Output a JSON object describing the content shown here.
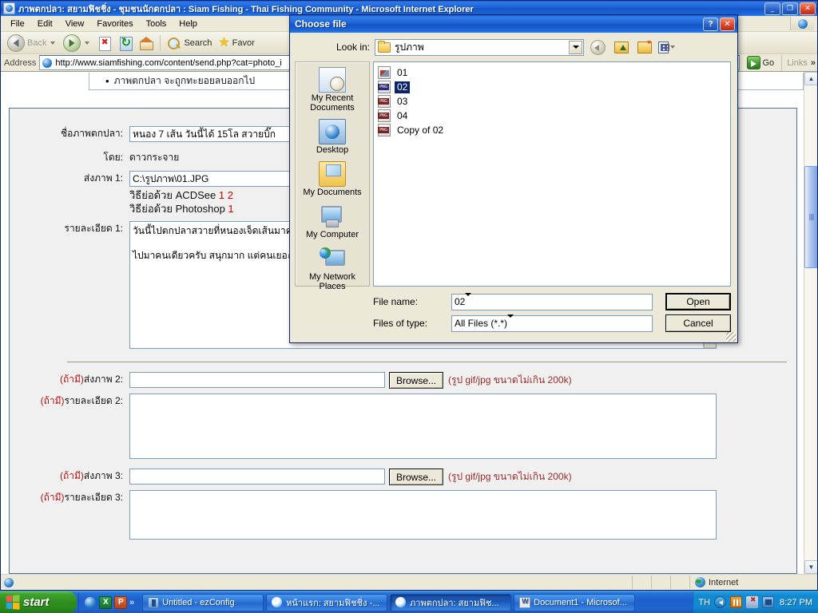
{
  "browser": {
    "title": "ภาพตกปลา: สยามฟิชชิ่ง - ชุมชนนักตกปลา : Siam Fishing - Thai Fishing Community - Microsoft Internet Explorer",
    "caption_buttons": {
      "minimize": "_",
      "restore": "❐",
      "close": "✕"
    },
    "menu": [
      "File",
      "Edit",
      "View",
      "Favorites",
      "Tools",
      "Help"
    ],
    "toolbar": {
      "back_label": "Back",
      "forward_label": "",
      "stop_label": "",
      "refresh_label": "",
      "home_label": "",
      "search_label": "Search",
      "favorites_label": "Favor"
    },
    "address": {
      "label": "Address",
      "url": "http://www.siamfishing.com/content/send.php?cat=photo_i",
      "go_label": "Go",
      "links_label": "Links",
      "links_chevron": "»"
    },
    "status": {
      "zone": "Internet"
    }
  },
  "page": {
    "notice": "ภาพตกปลา จะถูกทะยอยลบออกไป",
    "notice_bullet": "•",
    "form": {
      "row1": {
        "title_label": "ชื่อภาพตกปลา:",
        "title_value": "หนอง 7 เส้น วันนี้ได้ 15โล สวายบิ๊ก",
        "by_label": "โดย:",
        "by_value": "ดาวกระจาย",
        "file_label": "ส่งภาพ 1:",
        "file_value": "C:\\รูปภาพ\\01.JPG",
        "hint_acdsee_text": "วิธีย่อด้วย ACDSee",
        "hint_acdsee_links": [
          "1",
          "2"
        ],
        "hint_photoshop_text": "วิธีย่อด้วย Photoshop",
        "hint_photoshop_links": [
          "1"
        ],
        "detail_label": "รายละเอียด 1:",
        "detail_line1": "วันนี้ไปตกปลาสวายที่หนองเจ็ดเส้นมาครับ",
        "detail_line2": "ไปมาคนเดียวครับ สนุกมาก แต่คนเยอะมาก"
      },
      "row2": {
        "file_label_opt": "(ถ้ามี)",
        "file_label": "ส่งภาพ 2:",
        "file_value": "",
        "browse_label": "Browse...",
        "size_hint": "(รูป gif/jpg ขนาดไม่เกิน 200k)",
        "detail_label_opt": "(ถ้ามี)",
        "detail_label": "รายละเอียด 2:",
        "detail_value": ""
      },
      "row3": {
        "file_label_opt": "(ถ้ามี)",
        "file_label": "ส่งภาพ 3:",
        "file_value": "",
        "browse_label": "Browse...",
        "size_hint": "(รูป gif/jpg ขนาดไม่เกิน 200k)",
        "detail_label_opt": "(ถ้ามี)",
        "detail_label": "รายละเอียด 3:",
        "detail_value": ""
      }
    }
  },
  "dialog": {
    "title": "Choose file",
    "help_btn": "?",
    "close_btn": "✕",
    "lookin_label": "Look in:",
    "lookin_value": "รูปภาพ",
    "places": [
      {
        "label_line1": "My Recent",
        "label_line2": "Documents",
        "icon": "recent-documents-icon"
      },
      {
        "label_line1": "Desktop",
        "label_line2": "",
        "icon": "desktop-icon"
      },
      {
        "label_line1": "My Documents",
        "label_line2": "",
        "icon": "my-documents-icon"
      },
      {
        "label_line1": "My Computer",
        "label_line2": "",
        "icon": "my-computer-icon"
      },
      {
        "label_line1": "My Network",
        "label_line2": "Places",
        "icon": "my-network-places-icon"
      }
    ],
    "files": [
      {
        "name": "01",
        "icon": "jpg-file-icon",
        "selected": false
      },
      {
        "name": "02",
        "icon": "png-file-icon",
        "selected": true
      },
      {
        "name": "03",
        "icon": "png-file-icon",
        "selected": false
      },
      {
        "name": "04",
        "icon": "png-file-icon",
        "selected": false
      },
      {
        "name": "Copy of 02",
        "icon": "png-file-icon",
        "selected": false
      }
    ],
    "file_icon_tag": "PNG",
    "filename_label": "File name:",
    "filename_value": "02",
    "filetype_label": "Files of type:",
    "filetype_value": "All Files (*.*)",
    "open_label": "Open",
    "cancel_label": "Cancel"
  },
  "taskbar": {
    "start_label": "start",
    "quicklaunch_chevron": "»",
    "tasks": [
      {
        "label": "Untitled - ezConfig",
        "icon": "ezconfig-icon",
        "active": false
      },
      {
        "label": "หน้าแรก: สยามฟิชชิ่ง -...",
        "icon": "ie-icon",
        "active": false
      },
      {
        "label": "ภาพตกปลา: สยามฟิช...",
        "icon": "ie-icon",
        "active": true
      },
      {
        "label": "Document1 - Microsof...",
        "icon": "word-icon",
        "active": false
      }
    ],
    "tray": {
      "language": "TH",
      "time": "8:27 PM"
    }
  },
  "colors": {
    "title_blue": "#1e63d8",
    "selection_blue": "#0a246a",
    "required_red": "#b11111",
    "link_red": "#cc0000",
    "hint_red": "#9a2b2b",
    "face": "#ece9d8"
  }
}
